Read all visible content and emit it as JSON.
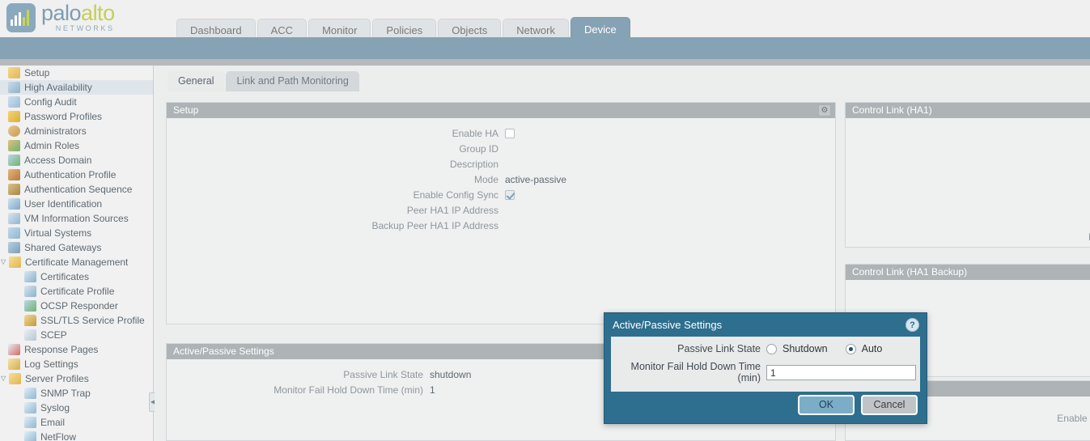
{
  "brand": {
    "name_part1": "palo",
    "name_part2": "alto",
    "tagline": "NETWORKS",
    "accent_blue": "#86a2b5",
    "accent_green": "#c3cf5a"
  },
  "nav": {
    "tabs": [
      {
        "label": "Dashboard",
        "active": false
      },
      {
        "label": "ACC",
        "active": false
      },
      {
        "label": "Monitor",
        "active": false
      },
      {
        "label": "Policies",
        "active": false
      },
      {
        "label": "Objects",
        "active": false
      },
      {
        "label": "Network",
        "active": false
      },
      {
        "label": "Device",
        "active": true
      }
    ]
  },
  "sidebar": {
    "items": [
      {
        "label": "Setup",
        "icon": "setup-icon",
        "level": 0,
        "selected": false,
        "twisty": ""
      },
      {
        "label": "High Availability",
        "icon": "high-availability-icon",
        "level": 0,
        "selected": true,
        "twisty": ""
      },
      {
        "label": "Config Audit",
        "icon": "config-audit-icon",
        "level": 0,
        "selected": false,
        "twisty": ""
      },
      {
        "label": "Password Profiles",
        "icon": "password-profiles-icon",
        "level": 0,
        "selected": false,
        "twisty": ""
      },
      {
        "label": "Administrators",
        "icon": "administrators-icon",
        "level": 0,
        "selected": false,
        "twisty": ""
      },
      {
        "label": "Admin Roles",
        "icon": "admin-roles-icon",
        "level": 0,
        "selected": false,
        "twisty": ""
      },
      {
        "label": "Access Domain",
        "icon": "access-domain-icon",
        "level": 0,
        "selected": false,
        "twisty": ""
      },
      {
        "label": "Authentication Profile",
        "icon": "authentication-profile-icon",
        "level": 0,
        "selected": false,
        "twisty": ""
      },
      {
        "label": "Authentication Sequence",
        "icon": "authentication-sequence-icon",
        "level": 0,
        "selected": false,
        "twisty": ""
      },
      {
        "label": "User Identification",
        "icon": "user-identification-icon",
        "level": 0,
        "selected": false,
        "twisty": ""
      },
      {
        "label": "VM Information Sources",
        "icon": "vm-information-sources-icon",
        "level": 0,
        "selected": false,
        "twisty": ""
      },
      {
        "label": "Virtual Systems",
        "icon": "virtual-systems-icon",
        "level": 0,
        "selected": false,
        "twisty": ""
      },
      {
        "label": "Shared Gateways",
        "icon": "shared-gateways-icon",
        "level": 0,
        "selected": false,
        "twisty": ""
      },
      {
        "label": "Certificate Management",
        "icon": "certificate-management-folder-icon",
        "level": 0,
        "selected": false,
        "twisty": "▽"
      },
      {
        "label": "Certificates",
        "icon": "certificates-icon",
        "level": 1,
        "selected": false,
        "twisty": ""
      },
      {
        "label": "Certificate Profile",
        "icon": "certificate-profile-icon",
        "level": 1,
        "selected": false,
        "twisty": ""
      },
      {
        "label": "OCSP Responder",
        "icon": "ocsp-responder-icon",
        "level": 1,
        "selected": false,
        "twisty": ""
      },
      {
        "label": "SSL/TLS Service Profile",
        "icon": "lock-icon",
        "level": 1,
        "selected": false,
        "twisty": ""
      },
      {
        "label": "SCEP",
        "icon": "scep-icon",
        "level": 1,
        "selected": false,
        "twisty": ""
      },
      {
        "label": "Response Pages",
        "icon": "response-pages-icon",
        "level": 0,
        "selected": false,
        "twisty": ""
      },
      {
        "label": "Log Settings",
        "icon": "log-settings-icon",
        "level": 0,
        "selected": false,
        "twisty": ""
      },
      {
        "label": "Server Profiles",
        "icon": "server-profiles-folder-icon",
        "level": 0,
        "selected": false,
        "twisty": "▽"
      },
      {
        "label": "SNMP Trap",
        "icon": "snmp-trap-icon",
        "level": 1,
        "selected": false,
        "twisty": ""
      },
      {
        "label": "Syslog",
        "icon": "syslog-icon",
        "level": 1,
        "selected": false,
        "twisty": ""
      },
      {
        "label": "Email",
        "icon": "email-icon",
        "level": 1,
        "selected": false,
        "twisty": ""
      },
      {
        "label": "NetFlow",
        "icon": "netflow-icon",
        "level": 1,
        "selected": false,
        "twisty": ""
      }
    ],
    "collapse_glyph": "◀"
  },
  "content": {
    "subtabs": [
      {
        "label": "General",
        "active": true
      },
      {
        "label": "Link and Path Monitoring",
        "active": false
      }
    ],
    "setup_panel": {
      "title": "Setup",
      "gear_glyph": "⚙",
      "rows": [
        {
          "label": "Enable HA",
          "type": "checkbox",
          "checked": false,
          "value": ""
        },
        {
          "label": "Group ID",
          "type": "text",
          "checked": false,
          "value": ""
        },
        {
          "label": "Description",
          "type": "text",
          "checked": false,
          "value": ""
        },
        {
          "label": "Mode",
          "type": "text",
          "checked": false,
          "value": "active-passive"
        },
        {
          "label": "Enable Config Sync",
          "type": "checkbox",
          "checked": true,
          "value": ""
        },
        {
          "label": "Peer HA1 IP Address",
          "type": "text",
          "checked": false,
          "value": ""
        },
        {
          "label": "Backup Peer HA1 IP Address",
          "type": "text",
          "checked": false,
          "value": ""
        }
      ]
    },
    "active_passive_panel": {
      "title": "Active/Passive Settings",
      "rows": [
        {
          "label": "Passive Link State",
          "value": "shutdown"
        },
        {
          "label": "Monitor Fail Hold Down Time (min)",
          "value": "1"
        }
      ]
    },
    "control_link_ha1": {
      "title": "Control Link (HA1)",
      "clipped_label": "M"
    },
    "control_link_ha1_backup": {
      "title": "Control Link (HA1 Backup)"
    },
    "third_panel": {
      "title": "",
      "clipped_label": "Enable S"
    }
  },
  "modal": {
    "title": "Active/Passive Settings",
    "help_glyph": "?",
    "passive_link_state": {
      "label": "Passive Link State",
      "options": [
        {
          "label": "Shutdown",
          "selected": false
        },
        {
          "label": "Auto",
          "selected": true
        }
      ]
    },
    "monitor_fail": {
      "label": "Monitor Fail Hold Down Time (min)",
      "value": "1"
    },
    "ok_label": "OK",
    "cancel_label": "Cancel"
  }
}
